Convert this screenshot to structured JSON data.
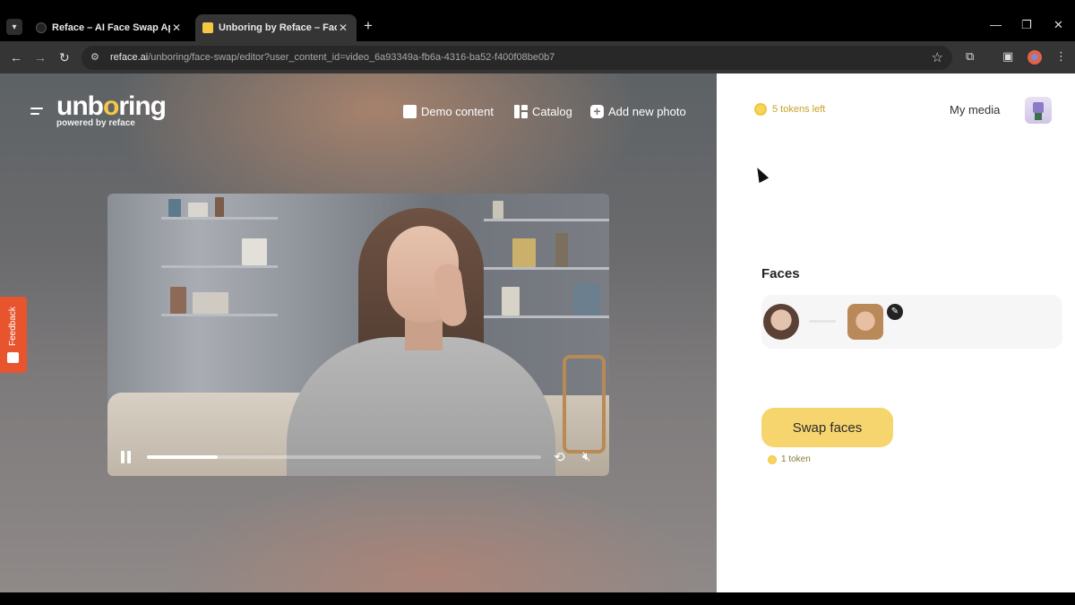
{
  "browser": {
    "tabs": [
      {
        "title": "Reface – AI Face Swap App & V",
        "active": false
      },
      {
        "title": "Unboring by Reface – Face Sw",
        "active": true
      }
    ],
    "url_host": "reface.ai",
    "url_path": "/unboring/face-swap/editor?user_content_id=video_6a93349a-fb6a-4316-ba52-f400f08be0b7"
  },
  "header": {
    "logo_main_a": "unb",
    "logo_main_o": "o",
    "logo_main_b": "ring",
    "logo_sub": "powered by reface",
    "nav": [
      {
        "label": "Demo content",
        "icon": "gift-icon"
      },
      {
        "label": "Catalog",
        "icon": "grid-icon"
      },
      {
        "label": "Add new photo",
        "icon": "plus-icon"
      }
    ]
  },
  "video": {
    "progress": 0.18,
    "state": "playing",
    "muted": true
  },
  "feedback": {
    "label": "Feedback"
  },
  "panel": {
    "tokens_label": "5 tokens left",
    "my_media": "My media",
    "faces_title": "Faces",
    "swap_button": "Swap faces",
    "cost_label": "1 token"
  },
  "colors": {
    "accent_yellow": "#f6d56e",
    "feedback_orange": "#e8542e",
    "token_text": "#c9a227"
  }
}
